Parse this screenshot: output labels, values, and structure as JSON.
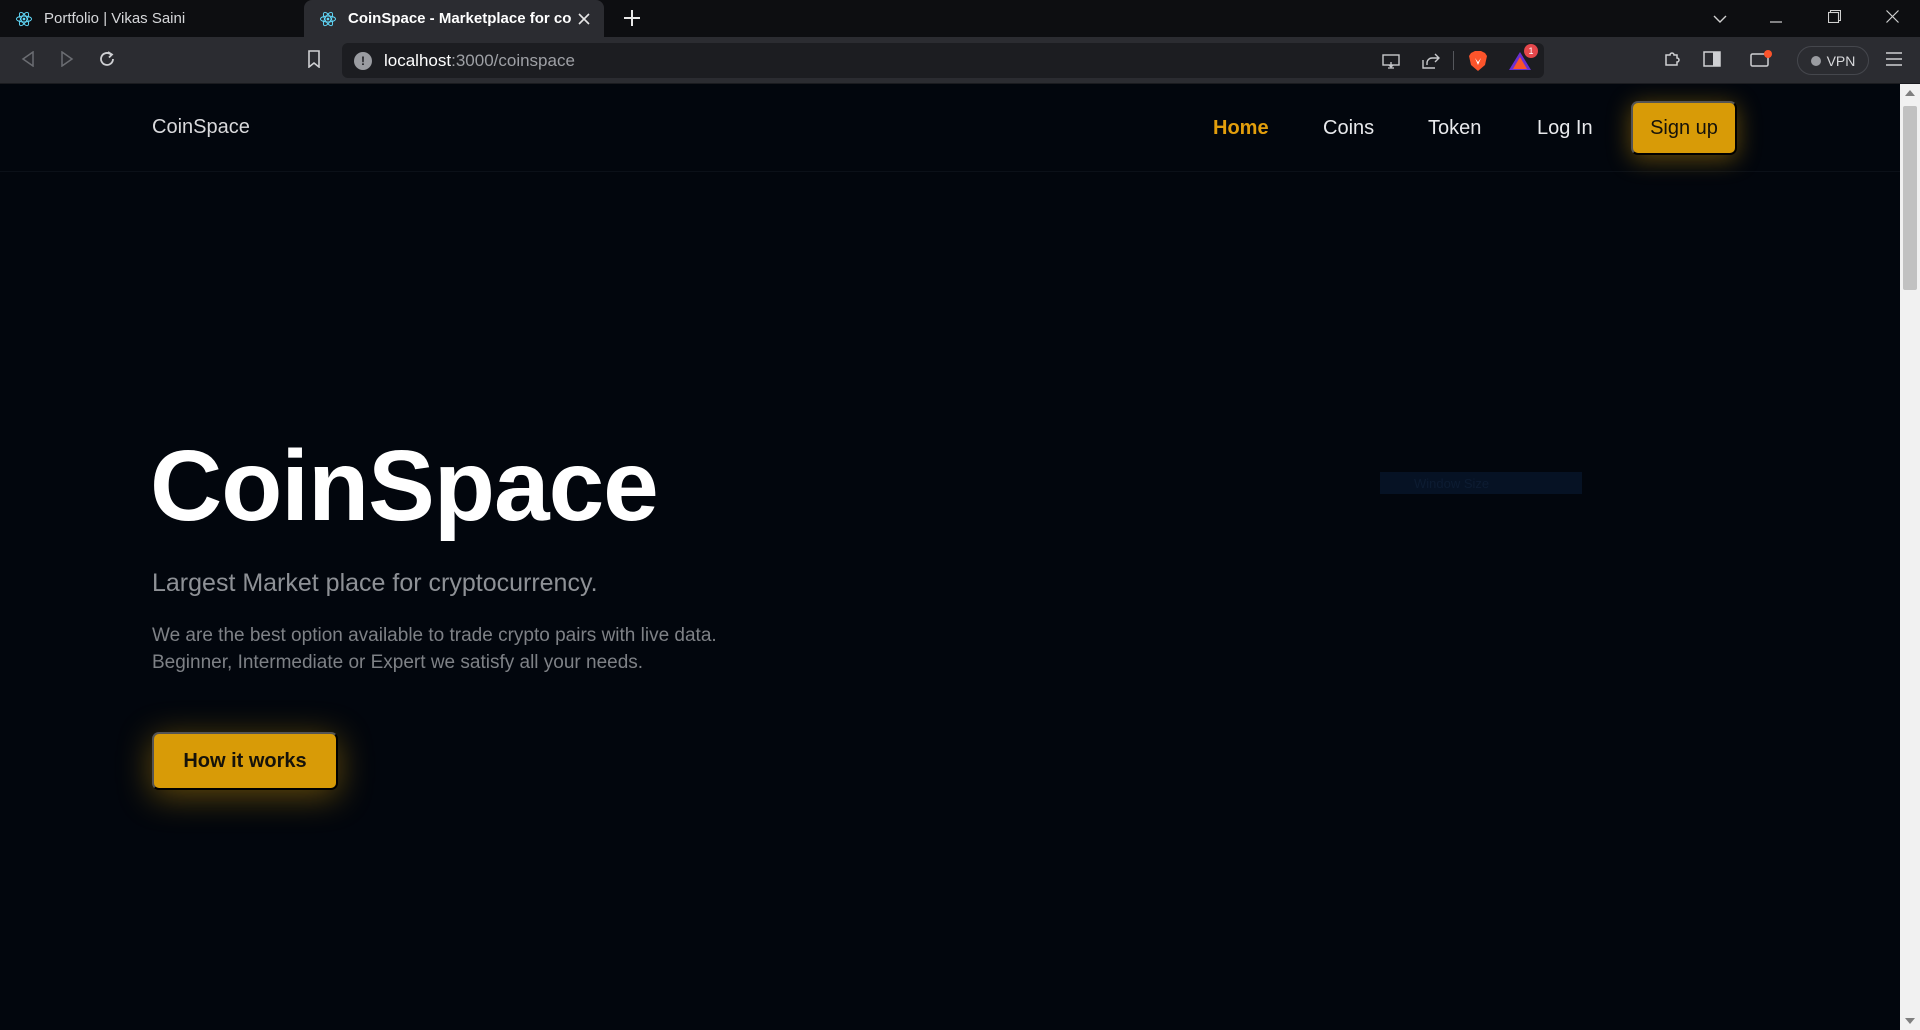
{
  "browser": {
    "tabs": [
      {
        "title": "Portfolio | Vikas Saini",
        "active": false
      },
      {
        "title": "CoinSpace - Marketplace for coin",
        "active": true
      }
    ],
    "url_host": "localhost",
    "url_path": ":3000/coinspace",
    "vpn_label": "VPN",
    "notification_count": "1",
    "icons": [
      "react-icon",
      "close-icon",
      "plus-icon",
      "chevron-down-icon",
      "minimize-icon",
      "restore-icon",
      "close-icon",
      "back-icon",
      "forward-icon",
      "reload-icon",
      "bookmark-icon",
      "info-icon",
      "cast-icon",
      "share-icon",
      "brave-shield-icon",
      "brave-rewards-icon",
      "extensions-icon",
      "sidebar-icon",
      "wallet-icon",
      "menu-icon"
    ]
  },
  "site": {
    "brand": "CoinSpace",
    "nav": [
      {
        "label": "Home",
        "active": true
      },
      {
        "label": "Coins",
        "active": false
      },
      {
        "label": "Token",
        "active": false
      },
      {
        "label": "Log In",
        "active": false
      }
    ],
    "signup_label": "Sign up",
    "hero": {
      "title": "CoinSpace",
      "subtitle": "Largest Market place for cryptocurrency.",
      "description_line1": "We are the best option available to trade crypto pairs with live data.",
      "description_line2": "Beginner, Intermediate or Expert we satisfy all your needs.",
      "cta_label": "How it works"
    },
    "ghost_label": "Window Size"
  },
  "colors": {
    "accent": "#d89b07",
    "nav_active": "#e29e0c",
    "background": "#02060d"
  }
}
